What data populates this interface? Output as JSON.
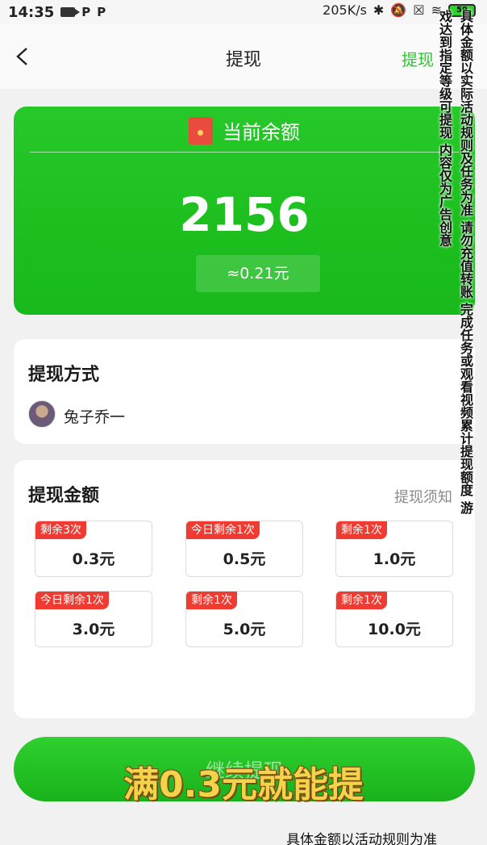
{
  "status_bar": {
    "time": "14:35",
    "network_speed": "205K/s",
    "battery": "59",
    "left_icons": [
      "camera-icon",
      "p-icon",
      "p-icon"
    ],
    "right_icons": [
      "bluetooth-icon",
      "mute-bell-icon",
      "sim-x-icon",
      "wifi-icon",
      "battery-icon"
    ]
  },
  "nav": {
    "title": "提现",
    "action": "提现"
  },
  "balance": {
    "label": "当前余额",
    "value": "2156",
    "sub": "≈0.21元"
  },
  "method": {
    "title": "提现方式",
    "user_name": "兔子乔一"
  },
  "amount": {
    "title": "提现金额",
    "notice_link": "提现须知",
    "options": [
      {
        "badge": "剩余3次",
        "value": "0.3元"
      },
      {
        "badge": "今日剩余1次",
        "value": "0.5元"
      },
      {
        "badge": "剩余1次",
        "value": "1.0元"
      },
      {
        "badge": "今日剩余1次",
        "value": "3.0元"
      },
      {
        "badge": "剩余1次",
        "value": "5.0元"
      },
      {
        "badge": "剩余1次",
        "value": "10.0元"
      }
    ]
  },
  "submit": {
    "label": "继续提现"
  },
  "overlay": {
    "caption": "满0.3元就能提",
    "disclaimer": "具体金额以活动规则为准",
    "vertical_text": "具体金额以实际活动规则及任务为准 请勿充值转账 完成任务或观看视频累计提现额度 游戏达到指定等级可提现 内容仅为广告创意"
  },
  "colors": {
    "brand_green": "#1fc321",
    "badge_red": "#ef3b31",
    "caption_yellow": "#f3d34a"
  }
}
